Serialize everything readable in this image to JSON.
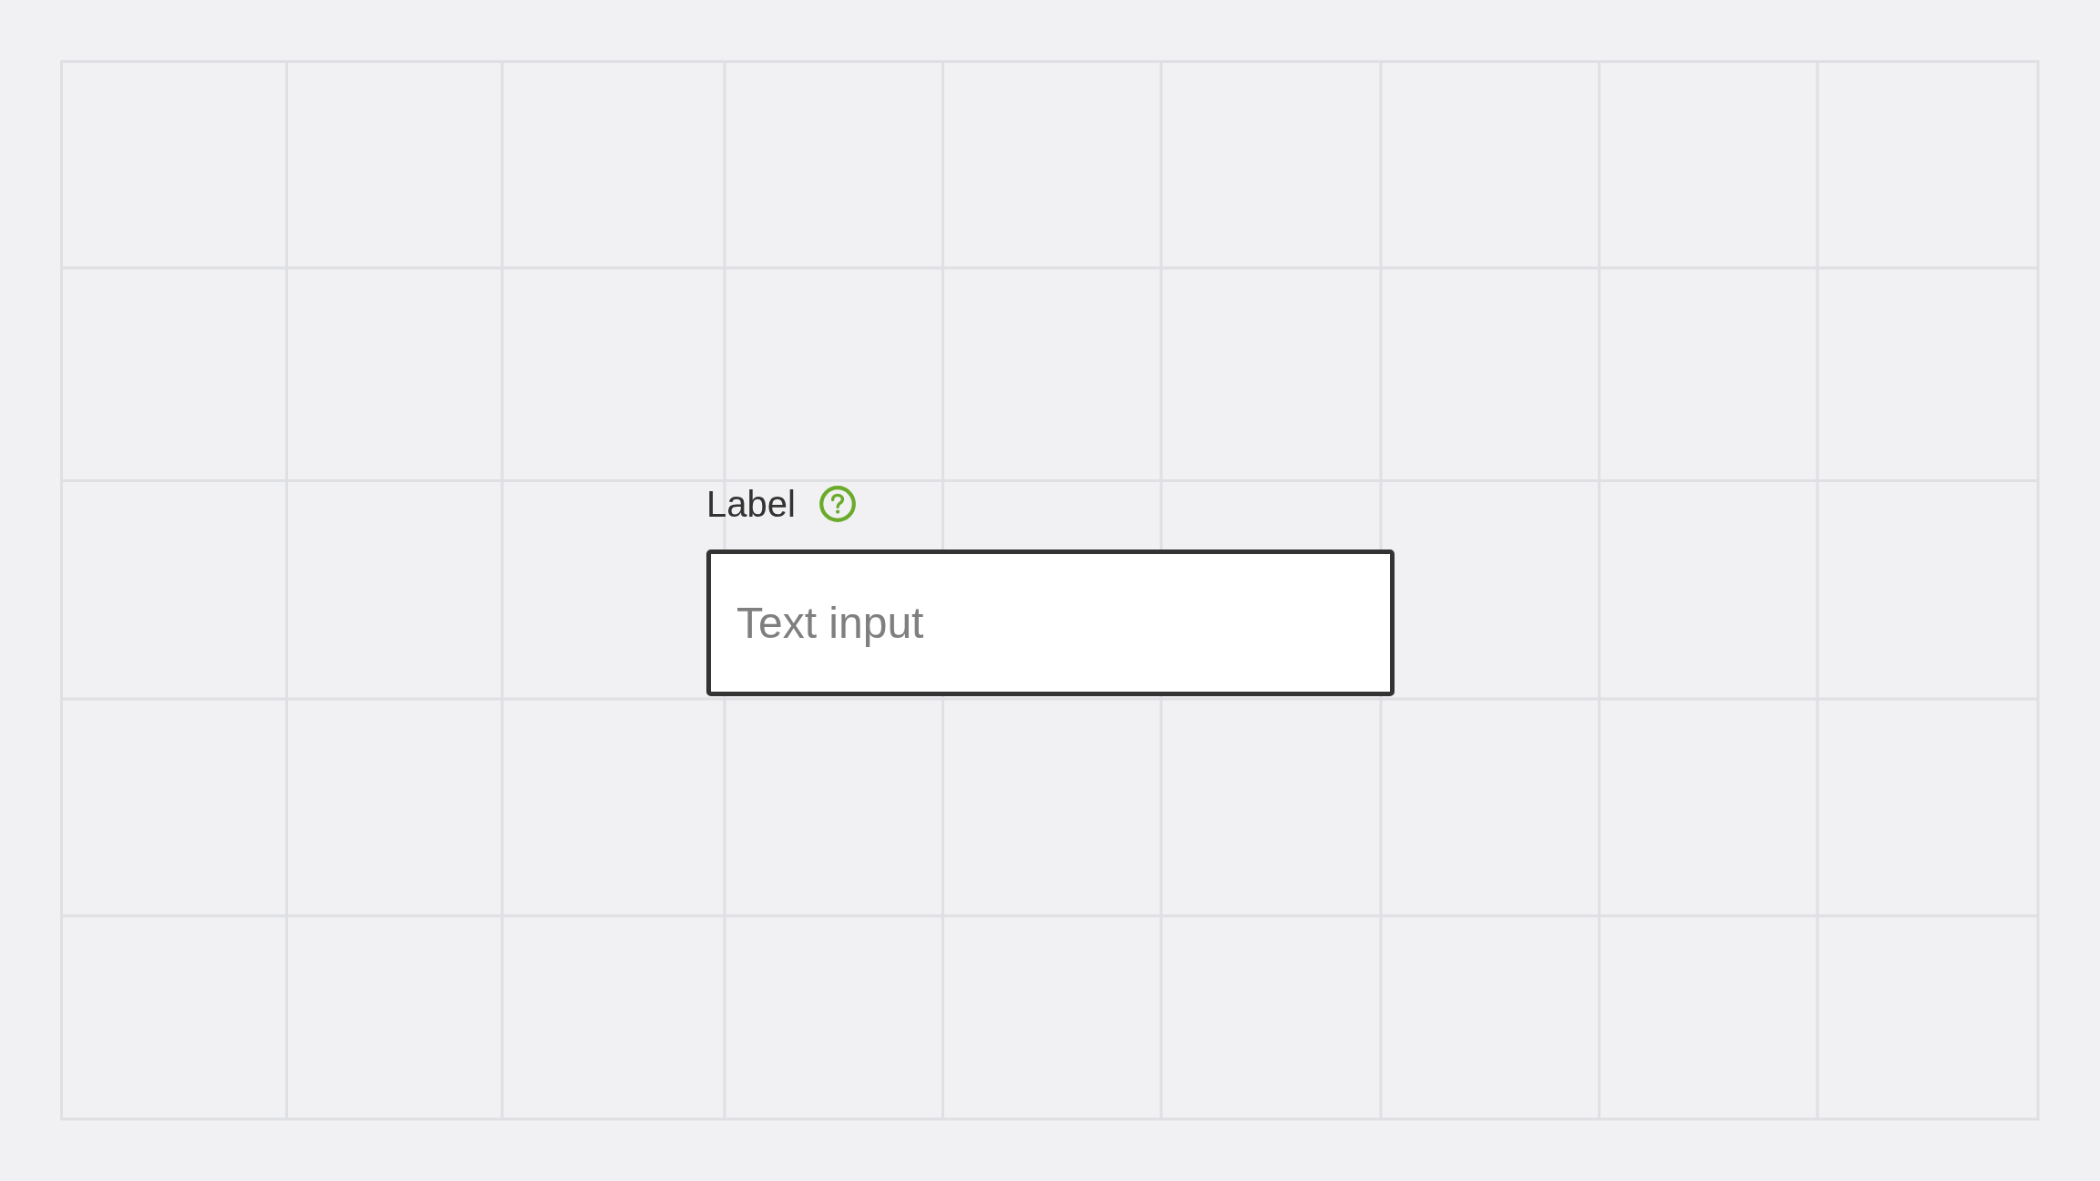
{
  "form_field": {
    "label": "Label",
    "placeholder": "Text input"
  }
}
